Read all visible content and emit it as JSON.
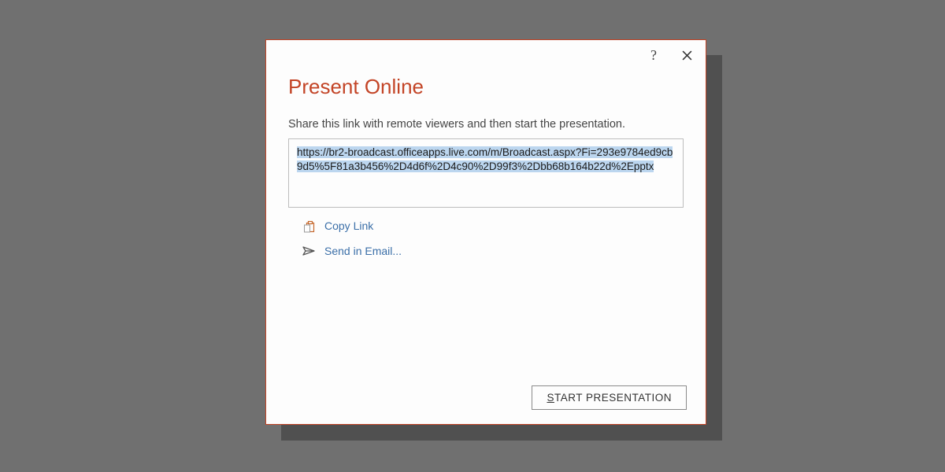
{
  "dialog": {
    "title": "Present Online",
    "instruction": "Share this link with remote viewers and then start the presentation.",
    "url": "https://br2-broadcast.officeapps.live.com/m/Broadcast.aspx?Fi=293e9784ed9cb9d5%5F81a3b456%2D4d6f%2D4c90%2D99f3%2Dbb68b164b22d%2Epptx",
    "actions": {
      "copy_label": "Copy Link",
      "email_label": "Send in Email..."
    },
    "help_tooltip": "?",
    "close_tooltip": "Close",
    "start_button": {
      "accel": "S",
      "rest": "TART PRESENTATION"
    }
  }
}
